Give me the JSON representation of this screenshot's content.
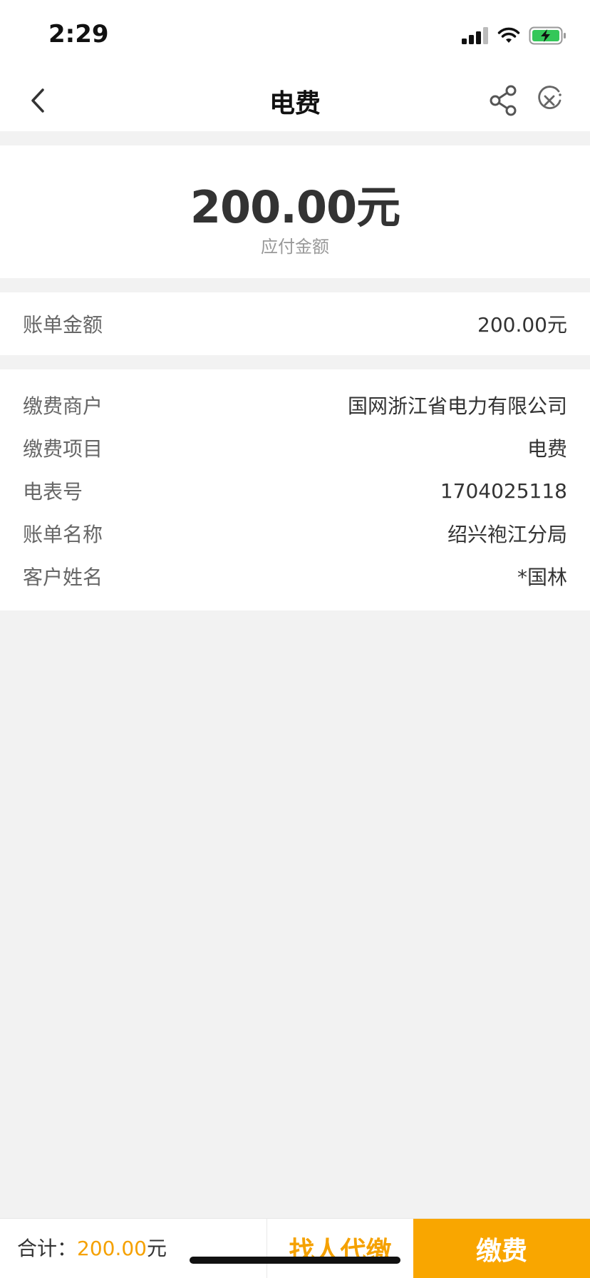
{
  "status_bar": {
    "time": "2:29"
  },
  "nav": {
    "title": "电费"
  },
  "summary": {
    "amount": "200.00元",
    "label": "应付金额"
  },
  "bill": {
    "label": "账单金额",
    "value": "200.00元"
  },
  "details": [
    {
      "label": "缴费商户",
      "value": "国网浙江省电力有限公司"
    },
    {
      "label": "缴费项目",
      "value": "电费"
    },
    {
      "label": "电表号",
      "value": "1704025118"
    },
    {
      "label": "账单名称",
      "value": "绍兴袍江分局"
    },
    {
      "label": "客户姓名",
      "value": "*国林"
    }
  ],
  "footer": {
    "total_label": "合计：",
    "total_amount": "200.00",
    "total_unit": "元",
    "proxy_button": "找人代缴",
    "pay_button": "缴费"
  },
  "colors": {
    "accent": "#f9a600",
    "accent_text": "#f5a100",
    "background": "#f2f2f2"
  },
  "icons": [
    "back-icon",
    "share-icon",
    "close-icon",
    "signal-icon",
    "wifi-icon",
    "battery-icon"
  ]
}
